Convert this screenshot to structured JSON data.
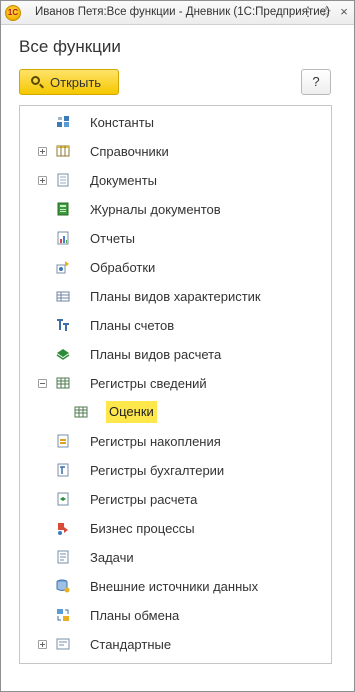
{
  "window": {
    "app_logo_text": "1C",
    "title": "Иванов Петя:Все функции - Дневник  (1С:Предприятие)",
    "controls": [
      "⋮",
      "☆",
      "×"
    ]
  },
  "page": {
    "title": "Все функции",
    "open_button_label": "Открыть",
    "help_button_label": "?"
  },
  "tree": {
    "items": [
      {
        "label": "Константы",
        "icon": "constants-icon",
        "expander": "none"
      },
      {
        "label": "Справочники",
        "icon": "catalogs-icon",
        "expander": "plus"
      },
      {
        "label": "Документы",
        "icon": "documents-icon",
        "expander": "plus"
      },
      {
        "label": "Журналы документов",
        "icon": "document-journals-icon",
        "expander": "none"
      },
      {
        "label": "Отчеты",
        "icon": "reports-icon",
        "expander": "none"
      },
      {
        "label": "Обработки",
        "icon": "data-processors-icon",
        "expander": "none"
      },
      {
        "label": "Планы видов характеристик",
        "icon": "characteristic-types-icon",
        "expander": "none"
      },
      {
        "label": "Планы счетов",
        "icon": "charts-of-accounts-icon",
        "expander": "none"
      },
      {
        "label": "Планы видов расчета",
        "icon": "calculation-types-icon",
        "expander": "none"
      },
      {
        "label": "Регистры сведений",
        "icon": "information-registers-icon",
        "expander": "minus"
      },
      {
        "label": "Оценки",
        "icon": "register-table-icon",
        "expander": "none",
        "selected": true
      },
      {
        "label": "Регистры накопления",
        "icon": "accumulation-registers-icon",
        "expander": "none"
      },
      {
        "label": "Регистры бухгалтерии",
        "icon": "accounting-registers-icon",
        "expander": "none"
      },
      {
        "label": "Регистры расчета",
        "icon": "calculation-registers-icon",
        "expander": "none"
      },
      {
        "label": "Бизнес процессы",
        "icon": "business-processes-icon",
        "expander": "none"
      },
      {
        "label": "Задачи",
        "icon": "tasks-icon",
        "expander": "none"
      },
      {
        "label": "Внешние источники данных",
        "icon": "external-data-sources-icon",
        "expander": "none"
      },
      {
        "label": "Планы обмена",
        "icon": "exchange-plans-icon",
        "expander": "none"
      },
      {
        "label": "Стандартные",
        "icon": "standard-icon",
        "expander": "plus"
      }
    ]
  }
}
